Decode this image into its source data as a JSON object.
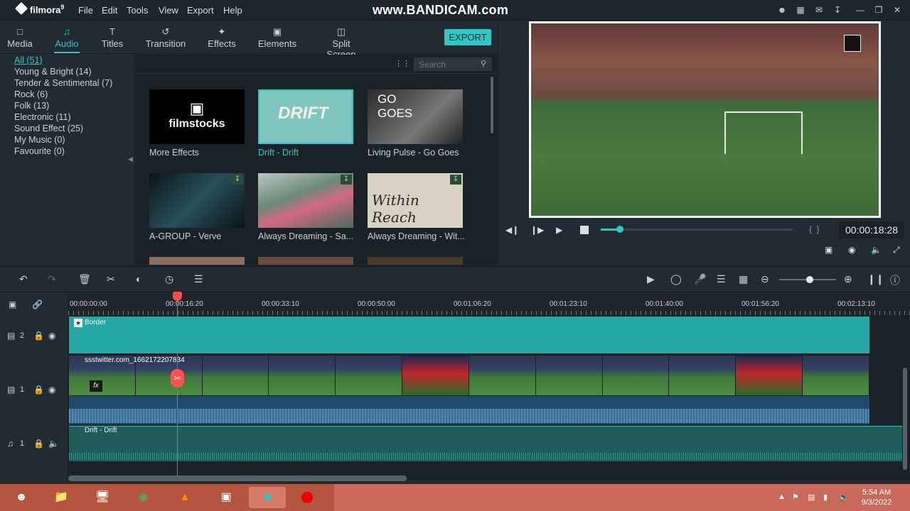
{
  "app": {
    "name": "filmora",
    "version": "9"
  },
  "menu": [
    "File",
    "Edit",
    "Tools",
    "View",
    "Export",
    "Help"
  ],
  "watermark": "www.BANDICAM.com",
  "media_tabs": [
    {
      "label": "Media",
      "icon": "folder-icon"
    },
    {
      "label": "Audio",
      "icon": "music-note-icon",
      "active": true
    },
    {
      "label": "Titles",
      "icon": "titles-icon"
    },
    {
      "label": "Transition",
      "icon": "transition-icon"
    },
    {
      "label": "Effects",
      "icon": "effects-icon"
    },
    {
      "label": "Elements",
      "icon": "elements-icon"
    },
    {
      "label": "Split Screen",
      "icon": "split-screen-icon"
    }
  ],
  "export_label": "EXPORT",
  "categories": [
    {
      "label": "All (51)",
      "selected": true
    },
    {
      "label": "Young & Bright (14)"
    },
    {
      "label": "Tender & Sentimental (7)"
    },
    {
      "label": "Rock (6)"
    },
    {
      "label": "Folk (13)"
    },
    {
      "label": "Electronic (11)"
    },
    {
      "label": "Sound Effect (25)"
    },
    {
      "label": "My Music (0)"
    },
    {
      "label": "Favourite (0)"
    }
  ],
  "search": {
    "placeholder": "Search"
  },
  "library": [
    {
      "label": "More Effects",
      "thumb_text": "filmstocks",
      "bg": "#000000"
    },
    {
      "label": "Drift - Drift",
      "thumb_text": "DRIFT",
      "bg": "#7fc6c0",
      "highlight": true
    },
    {
      "label": "Living Pulse - Go Goes",
      "thumb_text": "GO GOES",
      "bg": "#3a3a3a"
    },
    {
      "label": "A-GROUP - Verve",
      "thumb_text": "",
      "bg": "#0f1a20",
      "download": true
    },
    {
      "label": "Always Dreaming - Sa...",
      "thumb_text": "",
      "bg": "#6a8a7a",
      "download": true
    },
    {
      "label": "Always Dreaming - Wit...",
      "thumb_text": "Within Reach",
      "bg": "#d8d2c2",
      "download": true
    }
  ],
  "preview": {
    "timecode": "00:00:18:28",
    "progress": 0.1
  },
  "timeline": {
    "ruler": [
      "00:00:00:00",
      "00:00:16:20",
      "00:00:33:10",
      "00:00:50:00",
      "00:01:06:20",
      "00:01:23:10",
      "00:01:40:00",
      "00:01:56:20",
      "00:02:13:10"
    ],
    "tracks": [
      {
        "label": "2",
        "clip": "Border"
      },
      {
        "label": "1",
        "clip": "ssstwitter.com_1662172207834"
      },
      {
        "label": "1",
        "clip": "Drift - Drift"
      }
    ]
  },
  "taskbar": {
    "time": "5:54 AM",
    "date": "9/3/2022"
  }
}
